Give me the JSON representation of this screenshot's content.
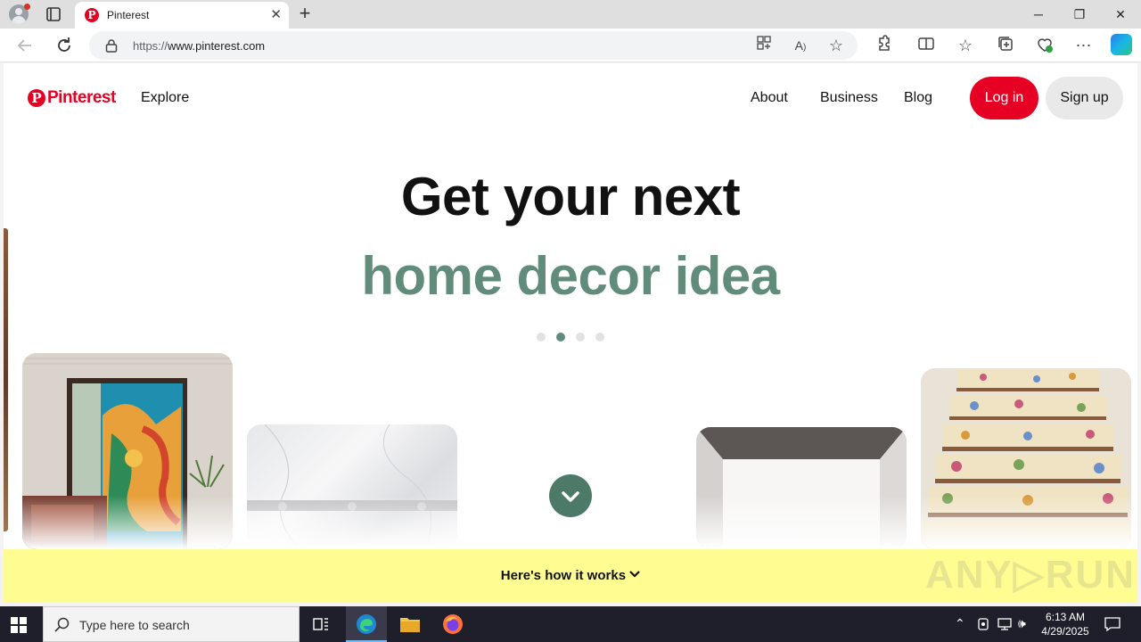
{
  "browser": {
    "tab_title": "Pinterest",
    "tab_favicon": "P",
    "new_tab_label": "+",
    "url": {
      "prefix": "https://",
      "host": "www.pinterest.com"
    },
    "icons": [
      "profile-icon",
      "tab-actions-icon",
      "back-icon",
      "refresh-icon",
      "lock-icon",
      "app-available-icon",
      "read-aloud-icon",
      "favorite-star-icon",
      "extensions-icon",
      "split-screen-icon",
      "favorites-icon",
      "collections-icon",
      "browser-essentials-icon",
      "more-icon",
      "copilot-icon"
    ]
  },
  "window_controls": {
    "minimize": "─",
    "restore": "❐",
    "close": "✕"
  },
  "header": {
    "logo_mark": "P",
    "logo_text": "Pinterest",
    "explore": "Explore",
    "about": "About",
    "business": "Business",
    "blog": "Blog",
    "login": "Log in",
    "signup": "Sign up"
  },
  "hero": {
    "line1": "Get your next",
    "line2": "home decor idea",
    "dots_total": 4,
    "dot_active": 2
  },
  "banner": {
    "text": "Here's how it works"
  },
  "watermark": "ANY▷RUN",
  "colors": {
    "brand_red": "#e60023",
    "hero_green": "#618c7b",
    "banner_yellow": "#fffd92"
  },
  "taskbar": {
    "search_placeholder": "Type here to search",
    "time": "6:13 AM",
    "date": "4/29/2025"
  }
}
